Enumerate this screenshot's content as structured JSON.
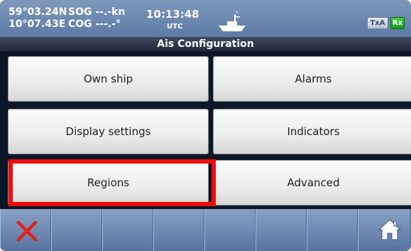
{
  "status": {
    "lat": "59°03.24N",
    "lon": "10°07.43E",
    "sog": "SOG --.-kn",
    "cog": "COG ---.-°",
    "time": "10:13:48",
    "tz": "UTC",
    "txa": "TxA",
    "rx": "Rx"
  },
  "title": "Ais Configuration",
  "menu": {
    "own_ship": "Own ship",
    "alarms": "Alarms",
    "display_settings": "Display settings",
    "indicators": "Indicators",
    "regions": "Regions",
    "advanced": "Advanced",
    "highlighted": "Regions"
  },
  "toolbar": {
    "left_icon": "close-icon",
    "right_icon": "home-icon"
  },
  "colors": {
    "statusbar": "#6f88b2",
    "highlight": "#ee0c0c",
    "close": "#e0201c",
    "rx_indicator": "#2db82a"
  }
}
